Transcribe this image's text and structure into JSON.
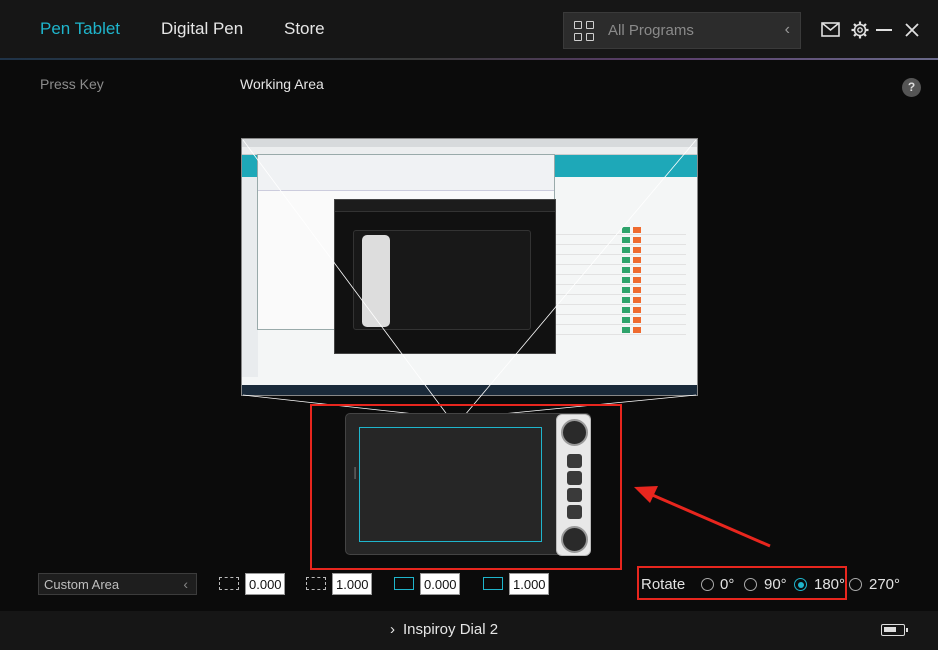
{
  "nav": {
    "tabs": [
      {
        "label": "Pen Tablet",
        "active": true
      },
      {
        "label": "Digital Pen",
        "active": false
      },
      {
        "label": "Store",
        "active": false
      }
    ],
    "program_select": {
      "label": "All Programs",
      "chevron": "‹"
    },
    "icons": [
      "mail-icon",
      "gear-icon",
      "minimize-icon",
      "close-icon"
    ]
  },
  "subheader": {
    "press_key": "Press Key",
    "working_area": "Working Area",
    "help": "?"
  },
  "mapping": {
    "area_select": "Custom Area",
    "area_chevron": "‹",
    "fields": [
      "0.000",
      "1.000",
      "0.000",
      "1.000"
    ]
  },
  "rotate": {
    "label": "Rotate",
    "options": [
      "0°",
      "90°",
      "180°",
      "270°"
    ],
    "selected": "180°"
  },
  "footer": {
    "device_chevron": "›",
    "device_name": "Inspiroy Dial 2"
  },
  "colors": {
    "accent": "#1fb5cc",
    "highlight": "#e8261e"
  }
}
